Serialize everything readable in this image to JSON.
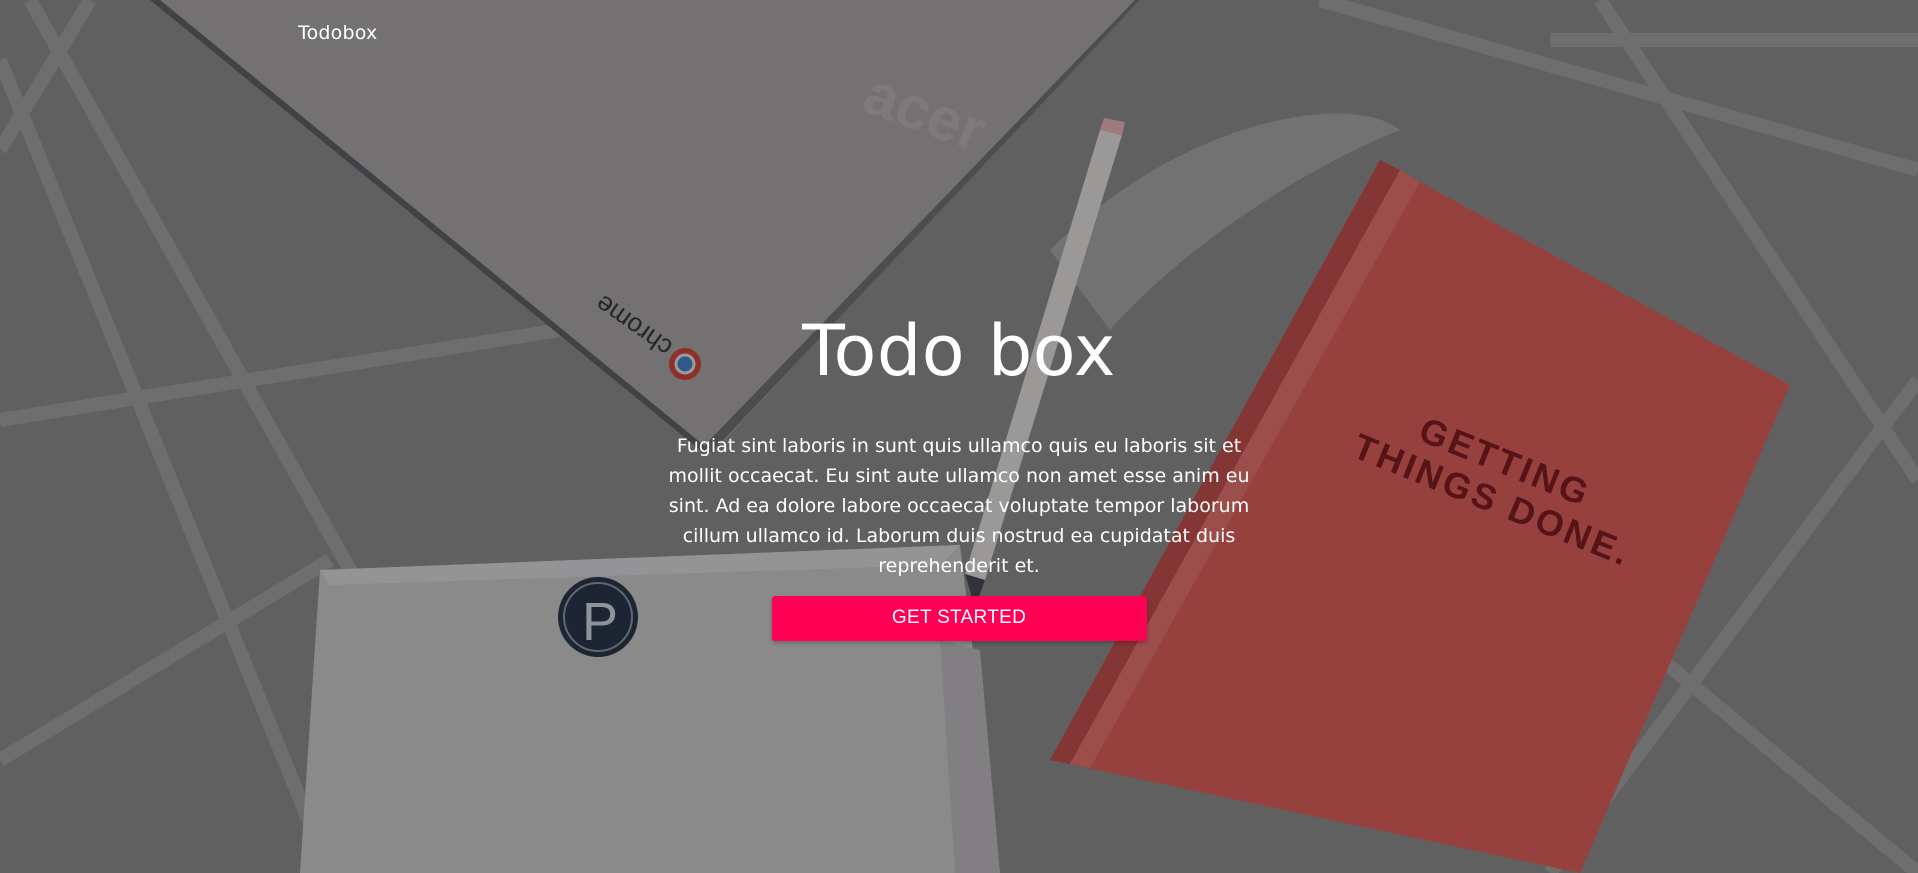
{
  "nav": {
    "brand": "Todobox"
  },
  "hero": {
    "title": "Todo box",
    "description": "Fugiat sint laboris in sunt quis ullamco quis eu laboris sit et mollit occaecat. Eu sint aute ullamco non amet esse anim eu sint. Ad ea dolore labore occaecat voluptate tempor laborum cillum ullamco id. Laborum duis nostrud ea cupidatat duis reprehenderit et.",
    "cta_label": "GET STARTED"
  },
  "background": {
    "laptop_brand_text": "chrome",
    "notebook_text_line1": "GETTING",
    "notebook_text_line2": "THINGS DONE.",
    "sticker_letter": "P"
  },
  "colors": {
    "accent": "#ff0055",
    "text": "#ffffff",
    "notebook": "#e0574f",
    "notebook_text": "#7a0d12"
  }
}
